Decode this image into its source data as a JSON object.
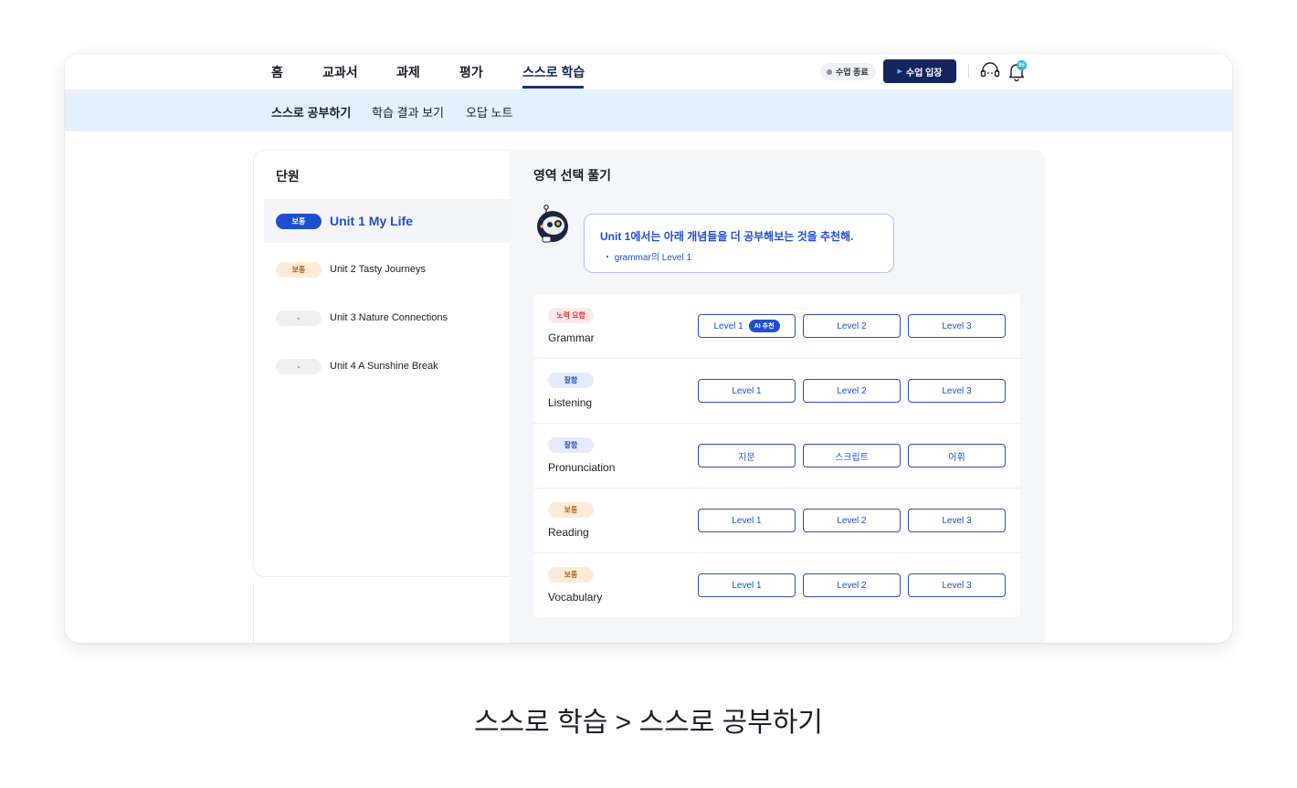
{
  "nav": {
    "items": [
      {
        "label": "홈"
      },
      {
        "label": "교과서"
      },
      {
        "label": "과제"
      },
      {
        "label": "평가"
      },
      {
        "label": "스스로 학습"
      }
    ],
    "status_label": "수업 종료",
    "enter_label": "수업 입장",
    "notification_count": "95",
    "colors": {
      "brand": "#15255e",
      "accent": "#1f4fd1",
      "badge": "#27b5e8"
    }
  },
  "subnav": {
    "items": [
      {
        "label": "스스로 공부하기"
      },
      {
        "label": "학습 결과 보기"
      },
      {
        "label": "오답 노트"
      }
    ]
  },
  "units": {
    "title": "단원",
    "items": [
      {
        "badge": "보통",
        "label": "Unit 1 My Life"
      },
      {
        "badge": "보통",
        "label": "Unit 2 Tasty Journeys"
      },
      {
        "badge": "-",
        "label": "Unit 3 Nature Connections"
      },
      {
        "badge": "-",
        "label": "Unit 4 A Sunshine Break"
      }
    ]
  },
  "practice": {
    "title": "영역 선택 풀기",
    "recommendation": {
      "main": "Unit 1에서는 아래 개념들을 더 공부해보는 것을 추천해.",
      "sub": "・ grammar의 Level 1"
    },
    "ai_tag": "AI 추천",
    "skills": [
      {
        "badge": "노력 요함",
        "name": "Grammar",
        "levels": [
          "Level 1",
          "Level 2",
          "Level 3"
        ]
      },
      {
        "badge": "잘함",
        "name": "Listening",
        "levels": [
          "Level 1",
          "Level 2",
          "Level 3"
        ]
      },
      {
        "badge": "잘함",
        "name": "Pronunciation",
        "levels": [
          "지문",
          "스크립트",
          "어휘"
        ]
      },
      {
        "badge": "보통",
        "name": "Reading",
        "levels": [
          "Level 1",
          "Level 2",
          "Level 3"
        ]
      },
      {
        "badge": "보통",
        "name": "Vocabulary",
        "levels": [
          "Level 1",
          "Level 2",
          "Level 3"
        ]
      }
    ]
  },
  "caption": "스스로 학습 > 스스로 공부하기"
}
